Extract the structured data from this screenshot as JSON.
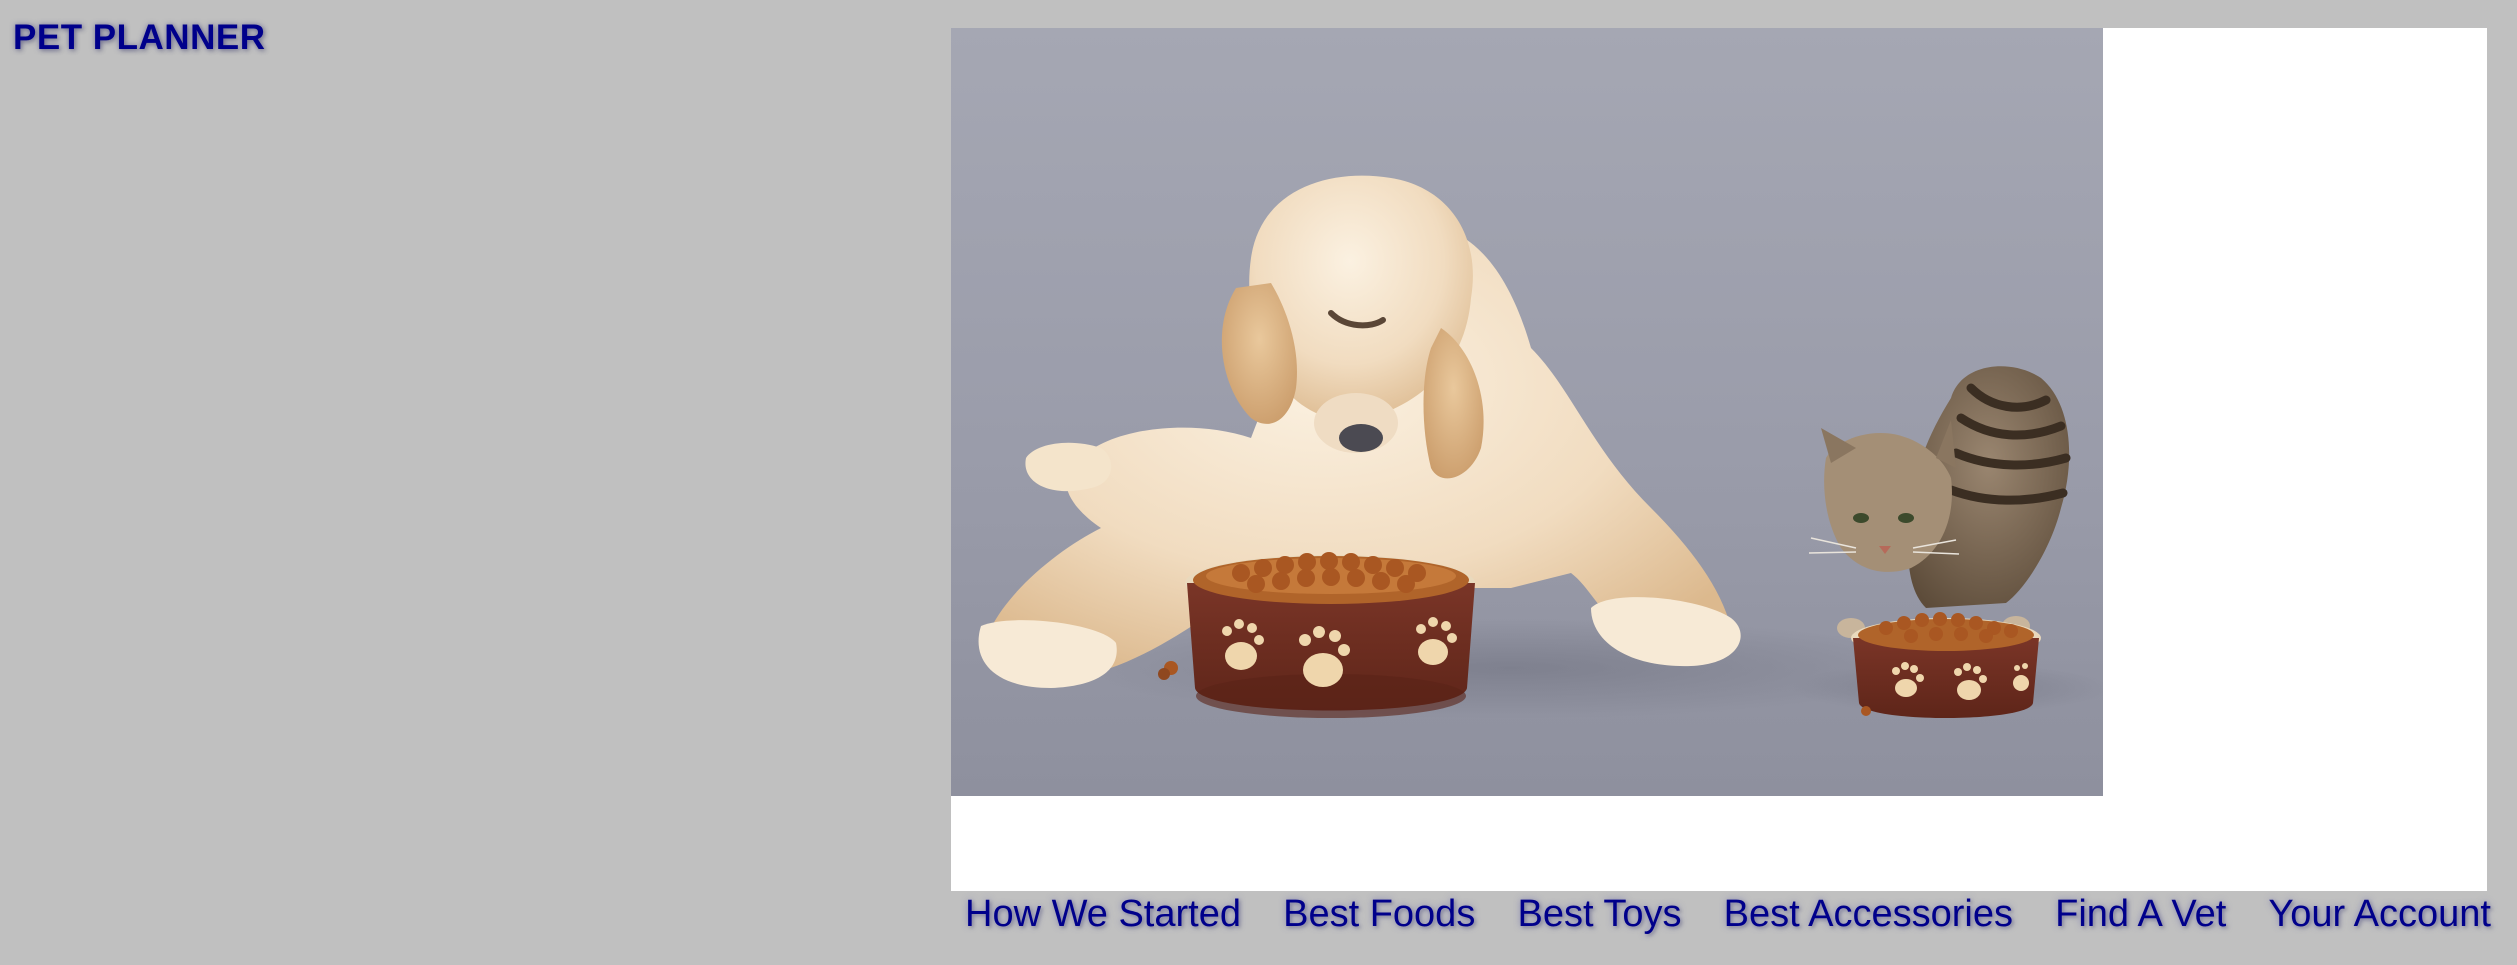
{
  "site": {
    "title": "PET PLANNER"
  },
  "hero": {
    "image_subject": "dog-and-cat-eating-from-food-bowls"
  },
  "nav": {
    "items": [
      {
        "label": "How We Started"
      },
      {
        "label": "Best Foods"
      },
      {
        "label": "Best Toys"
      },
      {
        "label": "Best Accessories"
      },
      {
        "label": "Find A Vet"
      },
      {
        "label": "Your Account"
      }
    ]
  },
  "colors": {
    "page_background": "#c0c0c0",
    "brand_text": "#00008b",
    "frame_background": "#ffffff"
  }
}
